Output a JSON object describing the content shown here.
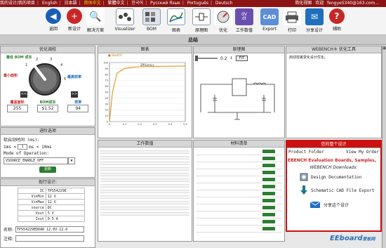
{
  "topbar": {
    "items": [
      "我的设计/我的项目",
      "English",
      "日本語",
      "简体中文",
      "繁體中文",
      "한국어",
      "Русский Язык",
      "Português",
      "Deutsch",
      "简化视图",
      "欢迎"
    ],
    "user": "fengye5340@163.com..."
  },
  "toolbar": {
    "buttons": [
      {
        "label": "返回",
        "icon": "back-arrow-icon"
      },
      {
        "label": "新设计",
        "icon": "new-design-icon"
      },
      {
        "label": "解决方案",
        "icon": "solutions-icon"
      },
      {
        "label": "Visualizer",
        "icon": "visualizer-icon"
      },
      {
        "label": "BOM",
        "icon": "bom-icon"
      },
      {
        "label": "图表",
        "icon": "charts-icon"
      },
      {
        "label": "原理图",
        "icon": "schematic-icon"
      },
      {
        "label": "优化",
        "icon": "optimize-icon"
      },
      {
        "label": "工作数值",
        "icon": "operating-values-icon"
      },
      {
        "label": "Export",
        "icon": "export-cad-icon"
      },
      {
        "label": "打印",
        "icon": "print-icon"
      },
      {
        "label": "分享设计",
        "icon": "share-icon"
      },
      {
        "label": "辅助",
        "icon": "help-icon"
      }
    ],
    "dv_text": "dV\ndt",
    "cad_text": "CAD"
  },
  "summary_title": "总结",
  "optimizer": {
    "title": "优化调校",
    "knob_labels": {
      "top_left": "最低 BOM 成本",
      "top": "成本",
      "left": "最小面积",
      "right": "最高效率"
    },
    "knob_numbers": [
      "1",
      "2",
      "3",
      "4",
      "5"
    ],
    "stats": [
      {
        "label": "覆盖面积",
        "value": "255",
        "color": "#c62828"
      },
      {
        "label": "BOM成本",
        "value": "$1.52",
        "color": "#2e7d32"
      },
      {
        "label": "效率",
        "value": "94",
        "color": "#1565c0"
      }
    ],
    "prev": "<<",
    "next": ">>"
  },
  "sequencing": {
    "title": "进阶选项",
    "soft_start_label": "软启动时间 (ms):",
    "min_label": "1ms <",
    "input_value": "1",
    "max_label": "ms < 10ms",
    "mode_label": "Mode of Operation:",
    "mode_value": "VSOURCE_ENABLE_OFF",
    "update_button": "更新"
  },
  "current_design": {
    "title": "现行设计:",
    "rows": [
      {
        "k": "IC",
        "v": "TPS54229E"
      },
      {
        "k": "VinMin",
        "v": "12 V"
      },
      {
        "k": "VinMax",
        "v": "12 V"
      },
      {
        "k": "source",
        "v": "DC"
      },
      {
        "k": "Vout",
        "v": "5 V"
      },
      {
        "k": "Iout",
        "v": "0.5 A"
      }
    ],
    "name_label": "名称:",
    "name_value": "TPS54229EDDAR 12.0V-12.0",
    "notes_label": "注释:"
  },
  "chart_panel": {
    "title": "图表",
    "legend": "Vout(V)",
    "plot_title": "Efficiency",
    "chart_data": {
      "type": "line",
      "title": "Efficiency",
      "xlabel": "",
      "ylabel": "",
      "ylim": [
        0,
        100
      ],
      "series": [
        {
          "name": "Vout(V)",
          "x": [
            0,
            0.02,
            0.05,
            0.1,
            0.15,
            0.2,
            0.3,
            0.4,
            0.5
          ],
          "values": [
            0,
            50,
            82,
            90,
            92,
            93,
            93.5,
            93.8,
            94
          ]
        }
      ],
      "yticks": [
        "100",
        "90",
        "80",
        "70",
        "60",
        "50",
        "40",
        "30",
        "20",
        "10",
        "0"
      ],
      "xticks": [
        "0",
        "0.1",
        "0.2",
        "0.3",
        "0.4",
        "0.5"
      ]
    }
  },
  "schematic_panel": {
    "title": "原理图",
    "zoom_value": "0.2",
    "fit_button": "FIT"
  },
  "webench_panel": {
    "title": "WEBENCH® 优化工具",
    "subtitle": "启动容差变化设计优化。"
  },
  "operating_panel": {
    "title": "工作数值",
    "rows": 24
  },
  "bom_panel": {
    "title": "材料清单",
    "rows": 12
  },
  "design_panel": {
    "title": "您的整个设计",
    "product_folder": "Product Folder",
    "view_order": "View My Order",
    "eval_text": "EBENCH Evaluation Boards, Samples,",
    "downloads": "WEBENCH Downloads:",
    "doc_link": "Design Documentation",
    "cad_link": "Schematic CAD File Export",
    "share_link": "分享这个设计"
  },
  "watermark": {
    "text": "EEboard",
    "suffix": "爱板网"
  }
}
